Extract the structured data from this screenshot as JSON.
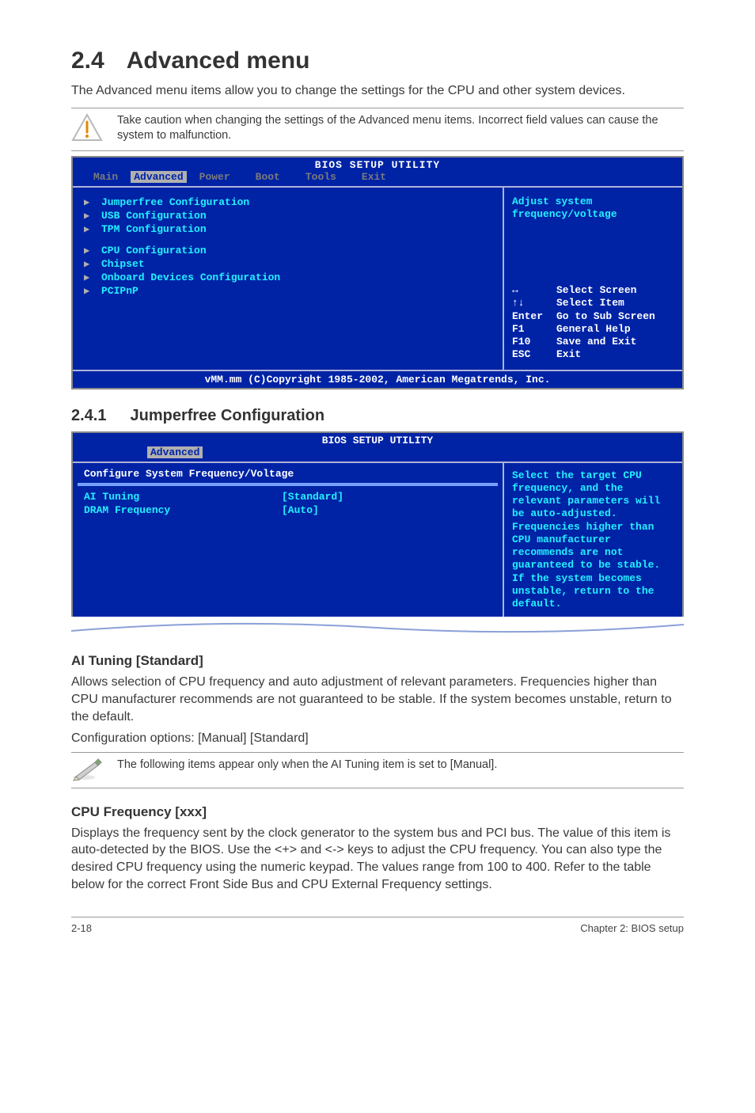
{
  "section": {
    "number": "2.4",
    "title": "Advanced menu",
    "intro": "The Advanced menu items allow you to change the settings for the CPU and other system devices.",
    "caution": "Take caution when changing the settings of the Advanced menu items. Incorrect field values can cause the system to malfunction."
  },
  "bios1": {
    "title": "BIOS SETUP UTILITY",
    "tabs": {
      "main": "Main",
      "advanced": "Advanced",
      "power": "Power",
      "boot": "Boot",
      "tools": "Tools",
      "exit": "Exit"
    },
    "menu": {
      "jumperfree": "Jumperfree Configuration",
      "usb": "USB Configuration",
      "tpm": "TPM Configuration",
      "cpu": "CPU Configuration",
      "chipset": "Chipset",
      "onboard": "Onboard Devices Configuration",
      "pcipnp": "PCIPnP"
    },
    "help_top_l1": "Adjust system",
    "help_top_l2": "frequency/voltage",
    "keys": {
      "lr": {
        "k": "↔",
        "d": "Select Screen"
      },
      "ud": {
        "k": "↑↓",
        "d": "Select Item"
      },
      "enter": {
        "k": "Enter",
        "d": "Go to Sub Screen"
      },
      "f1": {
        "k": "F1",
        "d": "General Help"
      },
      "f10": {
        "k": "F10",
        "d": "Save and Exit"
      },
      "esc": {
        "k": "ESC",
        "d": "Exit"
      }
    },
    "copyright": "vMM.mm (C)Copyright 1985-2002, American Megatrends, Inc."
  },
  "sub": {
    "number": "2.4.1",
    "title": "Jumperfree Configuration"
  },
  "bios2": {
    "title": "BIOS SETUP UTILITY",
    "tab": "Advanced",
    "header": "Configure System Frequency/Voltage",
    "rows": {
      "ai": {
        "label": "AI Tuning",
        "value": "[Standard]"
      },
      "dram": {
        "label": "DRAM Frequency",
        "value": "[Auto]"
      }
    },
    "help": "Select the target CPU frequency, and the relevant parameters will be auto-adjusted. Frequencies higher than CPU manufacturer recommends are not guaranteed to be stable. If the system becomes unstable, return to the default."
  },
  "ai_tuning": {
    "heading": "AI Tuning [Standard]",
    "p1": "Allows selection of CPU frequency and auto adjustment of relevant parameters. Frequencies higher than CPU manufacturer recommends are not guaranteed to be stable. If the system becomes unstable, return to the default.",
    "p2": "Configuration options: [Manual] [Standard]",
    "note": "The following items appear only when the AI Tuning item is set to [Manual]."
  },
  "cpu_freq": {
    "heading": "CPU Frequency [xxx]",
    "p": "Displays the frequency sent by the clock generator to the system bus and PCI bus. The value of this item is auto-detected by the BIOS. Use the <+> and <-> keys to adjust the CPU frequency. You can also type the desired CPU frequency using the numeric keypad. The values range from 100 to 400. Refer to the table below for the correct Front Side Bus and CPU External Frequency settings."
  },
  "footer": {
    "left": "2-18",
    "right": "Chapter 2: BIOS setup"
  }
}
